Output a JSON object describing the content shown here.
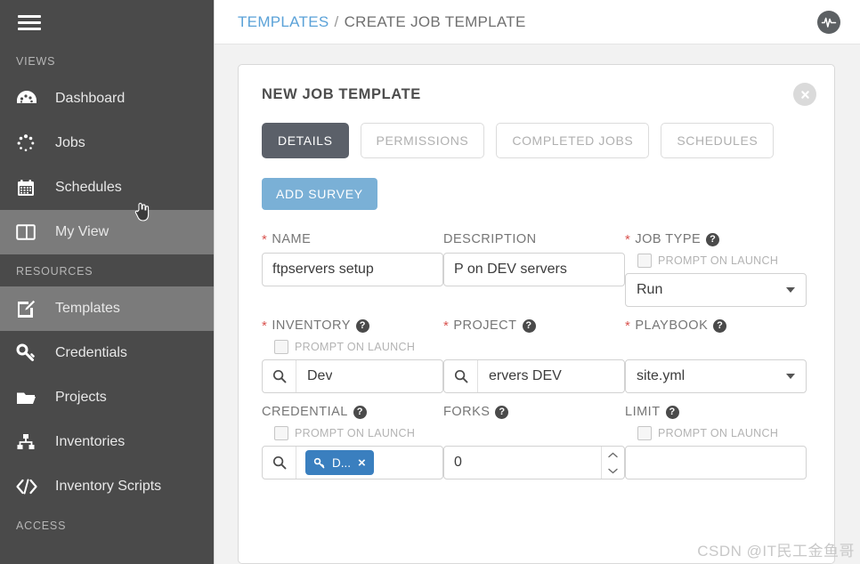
{
  "sidebar": {
    "menu_icon": "hamburger-icon",
    "sections": [
      {
        "title": "VIEWS",
        "items": [
          {
            "label": "Dashboard",
            "icon": "dashboard-icon",
            "active": false
          },
          {
            "label": "Jobs",
            "icon": "jobs-spinner-icon",
            "active": false
          },
          {
            "label": "Schedules",
            "icon": "calendar-icon",
            "active": false
          },
          {
            "label": "My View",
            "icon": "columns-icon",
            "active": true
          }
        ]
      },
      {
        "title": "RESOURCES",
        "items": [
          {
            "label": "Templates",
            "icon": "edit-template-icon",
            "active": true
          },
          {
            "label": "Credentials",
            "icon": "key-icon",
            "active": false
          },
          {
            "label": "Projects",
            "icon": "folder-icon",
            "active": false
          },
          {
            "label": "Inventories",
            "icon": "sitemap-icon",
            "active": false
          },
          {
            "label": "Inventory Scripts",
            "icon": "code-icon",
            "active": false
          }
        ]
      },
      {
        "title": "ACCESS",
        "items": []
      }
    ]
  },
  "topbar": {
    "breadcrumb_link": "TEMPLATES",
    "breadcrumb_separator": "/",
    "breadcrumb_current": "CREATE JOB TEMPLATE",
    "logo_icon": "ansible-tower-pulse-logo"
  },
  "card": {
    "title": "NEW JOB TEMPLATE",
    "close_icon": "close-circle-icon",
    "tabs": [
      {
        "label": "DETAILS",
        "active": true
      },
      {
        "label": "PERMISSIONS",
        "active": false
      },
      {
        "label": "COMPLETED JOBS",
        "active": false
      },
      {
        "label": "SCHEDULES",
        "active": false
      }
    ],
    "add_survey_label": "ADD SURVEY",
    "prompt_on_launch_label": "PROMPT ON LAUNCH",
    "help_glyph": "?",
    "fields": {
      "name": {
        "label": "NAME",
        "required": true,
        "value": "ftpservers setup"
      },
      "description": {
        "label": "DESCRIPTION",
        "required": false,
        "value": "P on DEV servers"
      },
      "job_type": {
        "label": "JOB TYPE",
        "required": true,
        "value": "Run",
        "prompt_on_launch": false
      },
      "inventory": {
        "label": "INVENTORY",
        "required": true,
        "value": "Dev",
        "prompt_on_launch": false,
        "search_icon": "search-icon"
      },
      "project": {
        "label": "PROJECT",
        "required": true,
        "value": "ervers DEV",
        "search_icon": "search-icon"
      },
      "playbook": {
        "label": "PLAYBOOK",
        "required": true,
        "value": "site.yml"
      },
      "credential": {
        "label": "CREDENTIAL",
        "required": false,
        "prompt_on_launch": false,
        "search_icon": "search-icon",
        "chip_label": "D...",
        "chip_icon": "key-icon",
        "chip_remove": "×"
      },
      "forks": {
        "label": "FORKS",
        "required": false,
        "value": "0"
      },
      "limit": {
        "label": "LIMIT",
        "required": false,
        "value": "",
        "prompt_on_launch": false
      }
    }
  },
  "watermark": {
    "text": "CSDN @IT民工金鱼哥"
  },
  "colors": {
    "sidebar_bg": "#4a4a4a",
    "sidebar_active": "#7b7b7b",
    "accent_blue": "#5ba2d8",
    "survey_blue": "#7ab0d6",
    "chip_blue": "#3a7fbf",
    "tab_active": "#5b6069",
    "required_red": "#d9534f"
  }
}
